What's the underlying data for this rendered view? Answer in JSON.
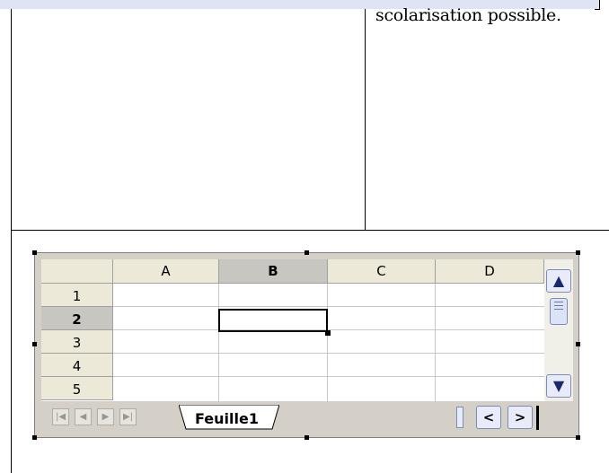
{
  "document": {
    "cell_text": "scolarisation possible."
  },
  "spreadsheet": {
    "columns": [
      "A",
      "B",
      "C",
      "D"
    ],
    "selected_column": "B",
    "rows": [
      "1",
      "2",
      "3",
      "4",
      "5"
    ],
    "selected_row": "2",
    "active_cell": "B2",
    "sheet_tab_label": "Feuille1",
    "nav_buttons": [
      "first-sheet",
      "previous-sheet",
      "next-sheet",
      "last-sheet"
    ],
    "scroll_up_label": "▲",
    "scroll_down_label": "▼",
    "scroll_left_label": "<",
    "scroll_right_label": ">"
  }
}
